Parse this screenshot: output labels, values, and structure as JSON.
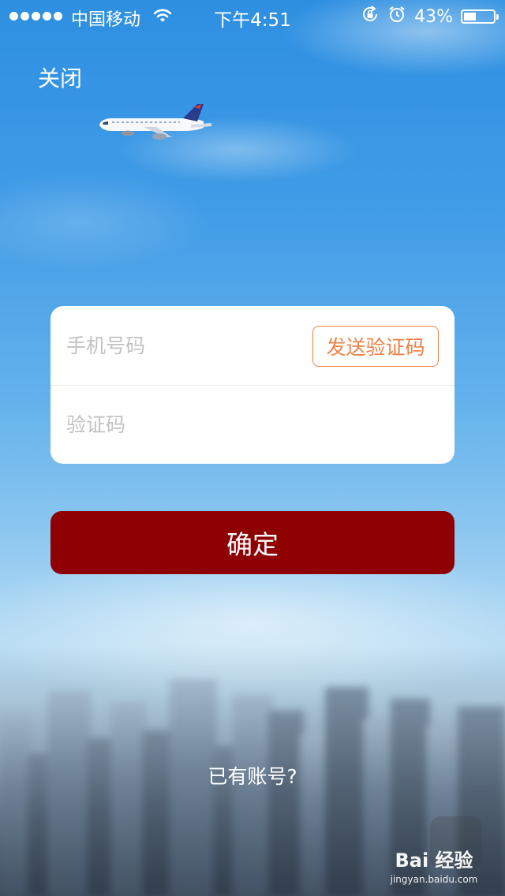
{
  "status_bar": {
    "carrier": "中国移动",
    "time": "下午4:51",
    "battery": "43%",
    "battery_level": 0.43,
    "icons": [
      "signal-dots-icon",
      "wifi-icon",
      "rotation-lock-icon",
      "alarm-icon",
      "battery-icon"
    ]
  },
  "header": {
    "close_label": "关闭"
  },
  "form": {
    "phone_placeholder": "手机号码",
    "send_code_label": "发送验证码",
    "code_placeholder": "验证码"
  },
  "actions": {
    "confirm_label": "确定",
    "have_account_label": "已有账号?"
  },
  "watermark": {
    "logo": "Bai 经验",
    "url": "jingyan.baidu.com"
  },
  "colors": {
    "confirm_button": "#8e0002",
    "send_code_accent": "#f07f45",
    "sky_top": "#2e8fe1"
  }
}
